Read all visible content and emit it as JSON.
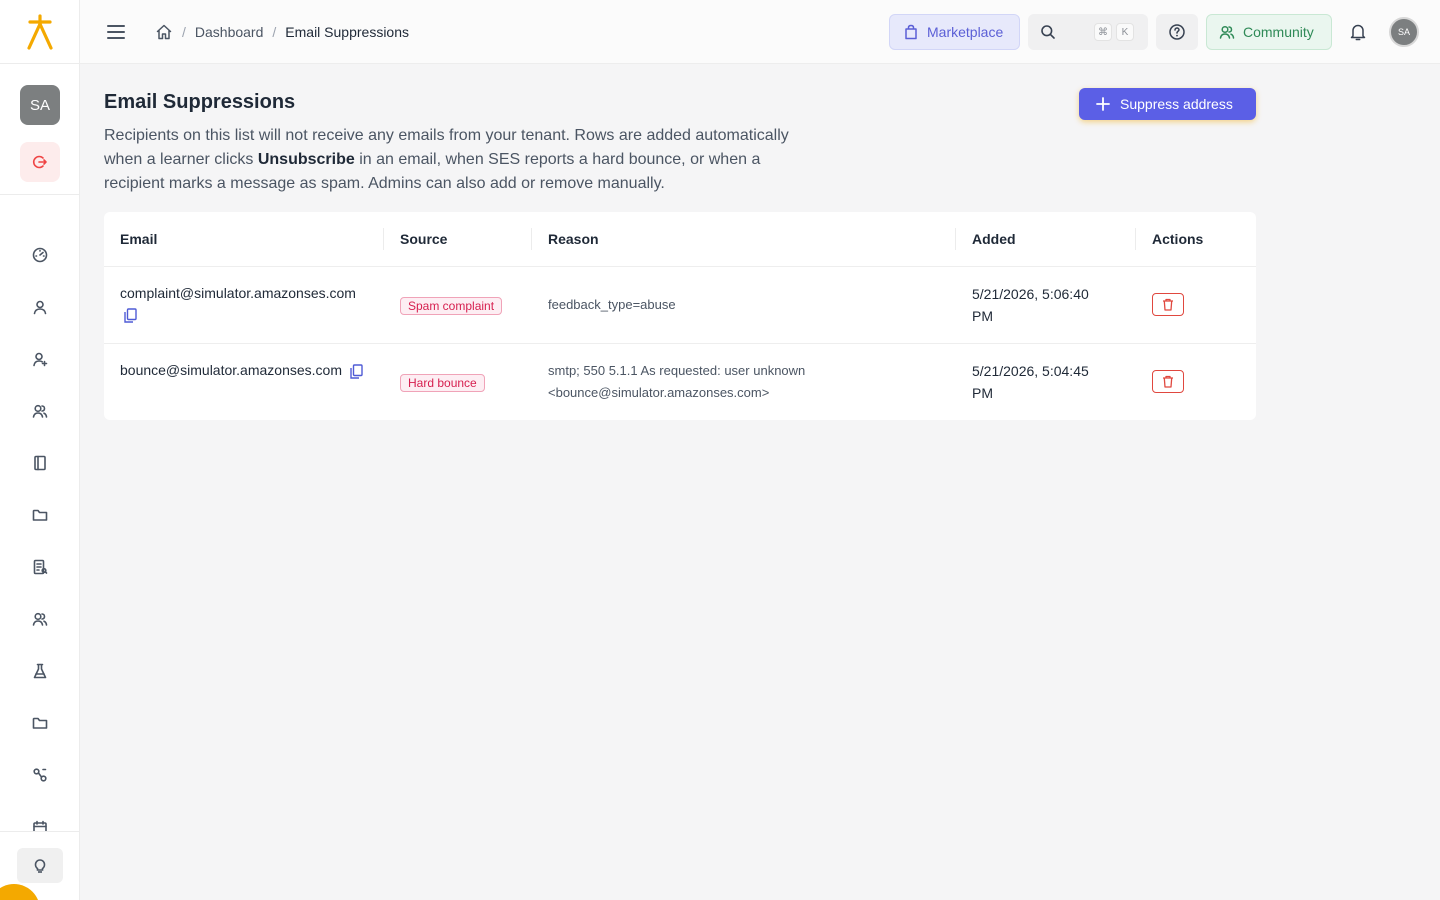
{
  "sidebar": {
    "avatar_initials": "SA",
    "nav_icons": [
      "dashboard-icon",
      "user-icon",
      "user-plus-icon",
      "users-icon",
      "book-icon",
      "folder-icon",
      "report-icon",
      "team-icon",
      "lab-icon",
      "folder-icon",
      "workflow-icon",
      "calendar-icon"
    ],
    "bottom_icon": "lightbulb-icon"
  },
  "header": {
    "breadcrumb": {
      "root_icon": "home-icon",
      "dashboard": "Dashboard",
      "current": "Email Suppressions",
      "separator": "/"
    },
    "marketplace_label": "Marketplace",
    "search_shortcut": {
      "key1": "⌘",
      "key2": "K"
    },
    "community_label": "Community",
    "avatar_initials": "SA"
  },
  "page": {
    "title": "Email Suppressions",
    "desc_part1": "Recipients on this list will not receive any emails from your tenant. Rows are added automatically when a learner clicks ",
    "desc_bold": "Unsubscribe",
    "desc_part2": " in an email, when SES reports a hard bounce, or when a recipient marks a message as spam. Admins can also add or remove manually.",
    "suppress_button": "Suppress address"
  },
  "table": {
    "columns": {
      "email": "Email",
      "source": "Source",
      "reason": "Reason",
      "added": "Added",
      "actions": "Actions"
    },
    "rows": [
      {
        "email": "complaint@simulator.amazonses.com",
        "source": "Spam complaint",
        "reason": "feedback_type=abuse",
        "added": "5/21/2026, 5:06:40 PM"
      },
      {
        "email": "bounce@simulator.amazonses.com",
        "source": "Hard bounce",
        "reason": "smtp; 550 5.1.1 As requested: user unknown <bounce@simulator.amazonses.com>",
        "added": "5/21/2026, 5:04:45 PM"
      }
    ]
  },
  "colors": {
    "accent": "#5b5fe6",
    "brand": "#f4a900",
    "danger": "#e0483f",
    "community": "#2f8a57"
  }
}
